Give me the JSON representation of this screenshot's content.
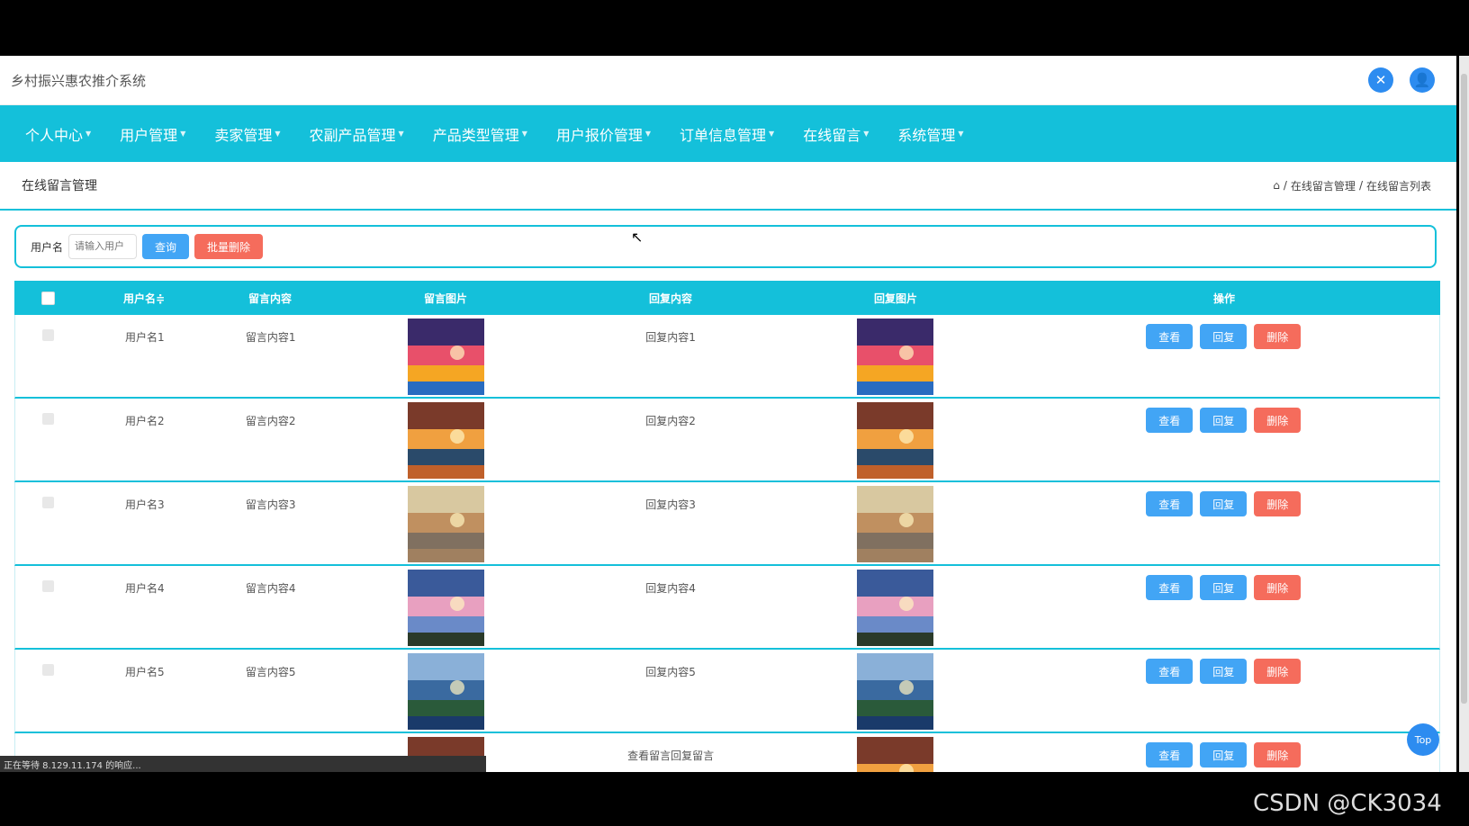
{
  "app": {
    "title": "乡村振兴惠农推介系统"
  },
  "nav": {
    "items": [
      {
        "label": "个人中心"
      },
      {
        "label": "用户管理"
      },
      {
        "label": "卖家管理"
      },
      {
        "label": "农副产品管理"
      },
      {
        "label": "产品类型管理"
      },
      {
        "label": "用户报价管理"
      },
      {
        "label": "订单信息管理"
      },
      {
        "label": "在线留言"
      },
      {
        "label": "系统管理"
      }
    ]
  },
  "page": {
    "title": "在线留言管理"
  },
  "breadcrumb": {
    "level1": "在线留言管理",
    "level2": "在线留言列表"
  },
  "search": {
    "label": "用户名",
    "placeholder": "请输入用户",
    "query_label": "查询",
    "batch_delete_label": "批量删除"
  },
  "table": {
    "headers": {
      "username": "用户名≑",
      "content": "留言内容",
      "image": "留言图片",
      "reply": "回复内容",
      "reply_image": "回复图片",
      "ops": "操作"
    },
    "rows": [
      {
        "username": "用户名1",
        "content": "留言内容1",
        "reply": "回复内容1",
        "image": "dolphin-sunset"
      },
      {
        "username": "用户名2",
        "content": "留言内容2",
        "reply": "回复内容2",
        "image": "harbor-sunset"
      },
      {
        "username": "用户名3",
        "content": "留言内容3",
        "reply": "回复内容3",
        "image": "misty-sea"
      },
      {
        "username": "用户名4",
        "content": "留言内容4",
        "reply": "回复内容4",
        "image": "pink-clouds"
      },
      {
        "username": "用户名5",
        "content": "留言内容5",
        "reply": "回复内容5",
        "image": "island-lake"
      },
      {
        "username": "",
        "content": "",
        "reply": "查看留言回复留言",
        "image": "harbor-sunset"
      }
    ],
    "ops": {
      "view": "查看",
      "reply": "回复",
      "delete": "删除"
    }
  },
  "status_bar": {
    "text": "正在等待 8.129.11.174 的响应..."
  },
  "back_to_top": {
    "label": "Top"
  },
  "watermark": {
    "text": "CSDN @CK3034"
  },
  "colors": {
    "accent": "#14c0da",
    "primary": "#42a5f5",
    "danger": "#f56c5c"
  }
}
